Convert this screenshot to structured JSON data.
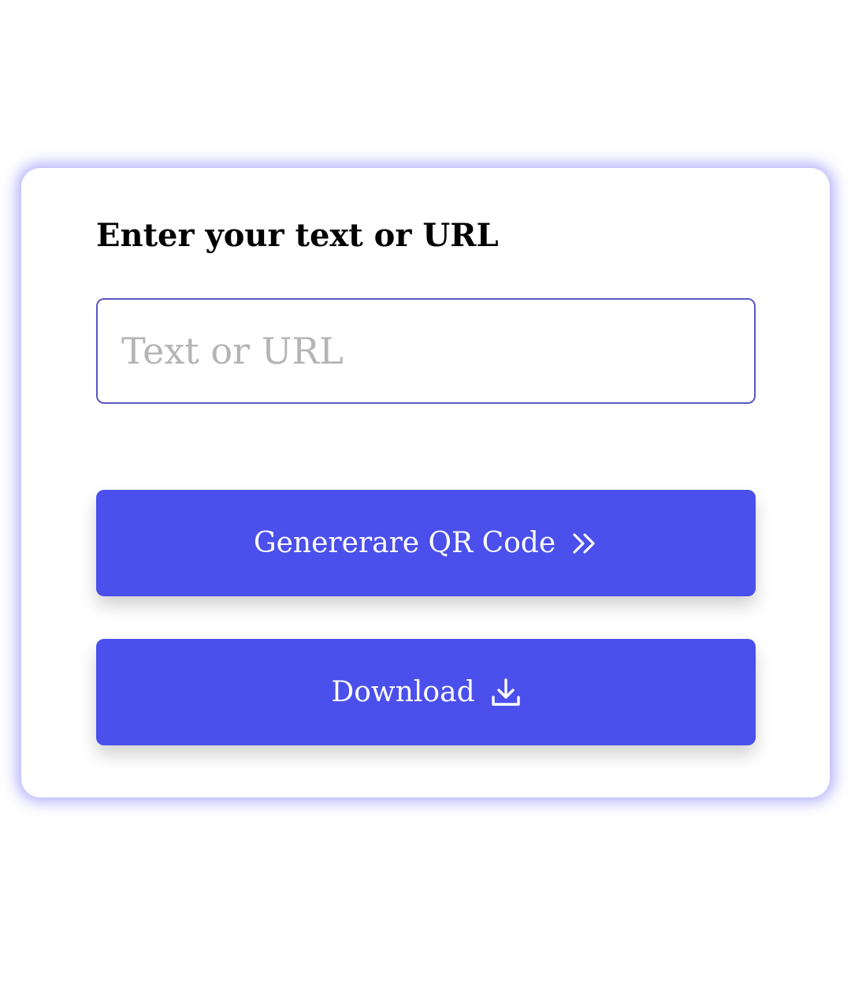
{
  "form": {
    "title": "Enter your text or URL",
    "input": {
      "placeholder": "Text or URL",
      "value": ""
    },
    "generate_button": {
      "label": "Genererare QR Code",
      "icon": "double-chevron-right-icon"
    },
    "download_button": {
      "label": "Download",
      "icon": "download-icon"
    }
  },
  "colors": {
    "accent": "#4b4feb",
    "input_border": "#5a56c4",
    "card_glow": "#7873f5",
    "placeholder": "#b4b4b4"
  }
}
